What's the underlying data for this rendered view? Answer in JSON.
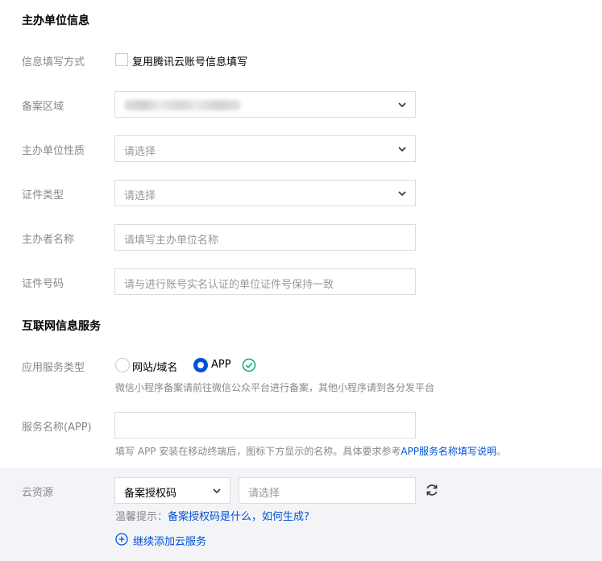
{
  "sections": {
    "sponsor_title": "主办单位信息",
    "internet_title": "互联网信息服务"
  },
  "sponsor": {
    "fill_method": {
      "label": "信息填写方式",
      "checkbox_label": "复用腾讯云账号信息填写",
      "checked": false
    },
    "region": {
      "label": "备案区域",
      "value_blurred": true
    },
    "nature": {
      "label": "主办单位性质",
      "placeholder": "请选择"
    },
    "cert_type": {
      "label": "证件类型",
      "placeholder": "请选择"
    },
    "name": {
      "label": "主办者名称",
      "placeholder": "请填写主办单位名称"
    },
    "cert_no": {
      "label": "证件号码",
      "placeholder": "请与进行账号实名认证的单位证件号保持一致"
    }
  },
  "service": {
    "type": {
      "label": "应用服务类型",
      "options": [
        "网站/域名",
        "APP"
      ],
      "selected": "APP",
      "hint": "微信小程序备案请前往微信公众平台进行备案，其他小程序请到各分发平台"
    },
    "name": {
      "label": "服务名称(APP)",
      "value": "",
      "hint_prefix": "填写 APP 安装在移动终端后，图标下方显示的名称。具体要求参考",
      "hint_link": "APP服务名称填写说明",
      "hint_suffix": "。"
    }
  },
  "cloud": {
    "label": "云资源",
    "type_select": "备案授权码",
    "value_placeholder": "请选择",
    "tip_prefix": "温馨提示：",
    "tip_link": "备案授权码是什么，如何生成?",
    "add_label": "继续添加云服务"
  },
  "colors": {
    "accent": "#0052d9",
    "success": "#00a870",
    "band": "#f3f4f7"
  }
}
